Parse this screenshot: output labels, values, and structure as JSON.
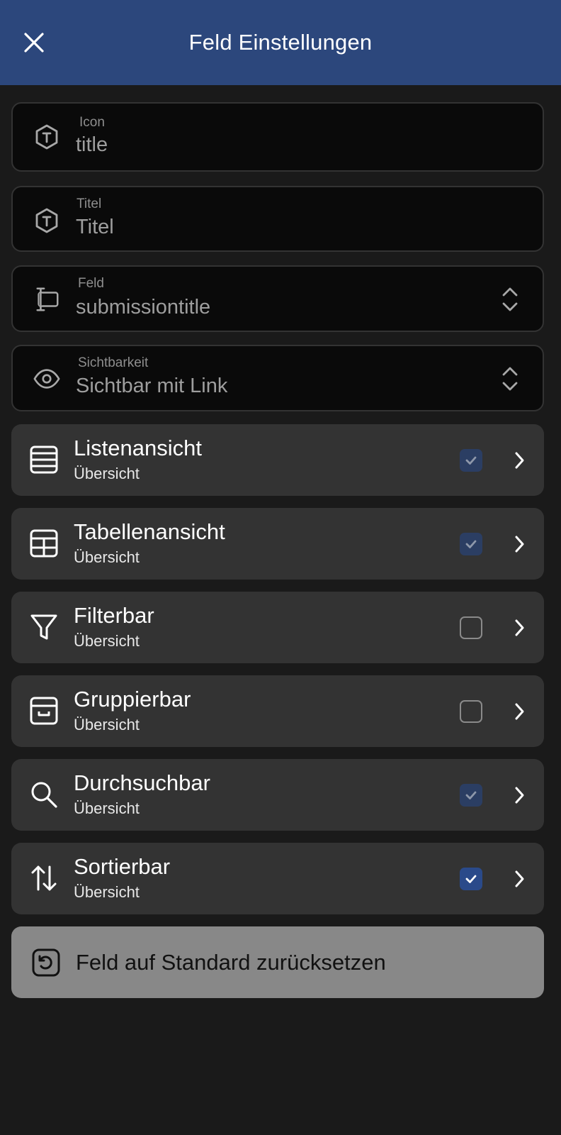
{
  "header": {
    "title": "Feld Einstellungen"
  },
  "fields": [
    {
      "label": "Icon",
      "value": "title"
    },
    {
      "label": "Titel",
      "value": "Titel"
    },
    {
      "label": "Feld",
      "value": "submissiontitle"
    },
    {
      "label": "Sichtbarkeit",
      "value": "Sichtbar mit Link"
    }
  ],
  "rows": [
    {
      "title": "Listenansicht",
      "subtitle": "Übersicht",
      "checked": true,
      "enabled": false,
      "icon": "list-icon"
    },
    {
      "title": "Tabellenansicht",
      "subtitle": "Übersicht",
      "checked": true,
      "enabled": false,
      "icon": "table-icon"
    },
    {
      "title": "Filterbar",
      "subtitle": "Übersicht",
      "checked": false,
      "enabled": true,
      "icon": "filter-icon"
    },
    {
      "title": "Gruppierbar",
      "subtitle": "Übersicht",
      "checked": false,
      "enabled": true,
      "icon": "archive-icon"
    },
    {
      "title": "Durchsuchbar",
      "subtitle": "Übersicht",
      "checked": true,
      "enabled": false,
      "icon": "search-icon"
    },
    {
      "title": "Sortierbar",
      "subtitle": "Übersicht",
      "checked": true,
      "enabled": true,
      "icon": "sort-icon"
    }
  ],
  "reset": {
    "label": "Feld auf Standard zurücksetzen"
  },
  "colors": {
    "header": "#2c477c",
    "background": "#1a1a1a",
    "row": "#333333",
    "checkbox_on": "#2a4a8a",
    "checkbox_disabled": "#2b3e63",
    "reset_button": "#888888"
  }
}
